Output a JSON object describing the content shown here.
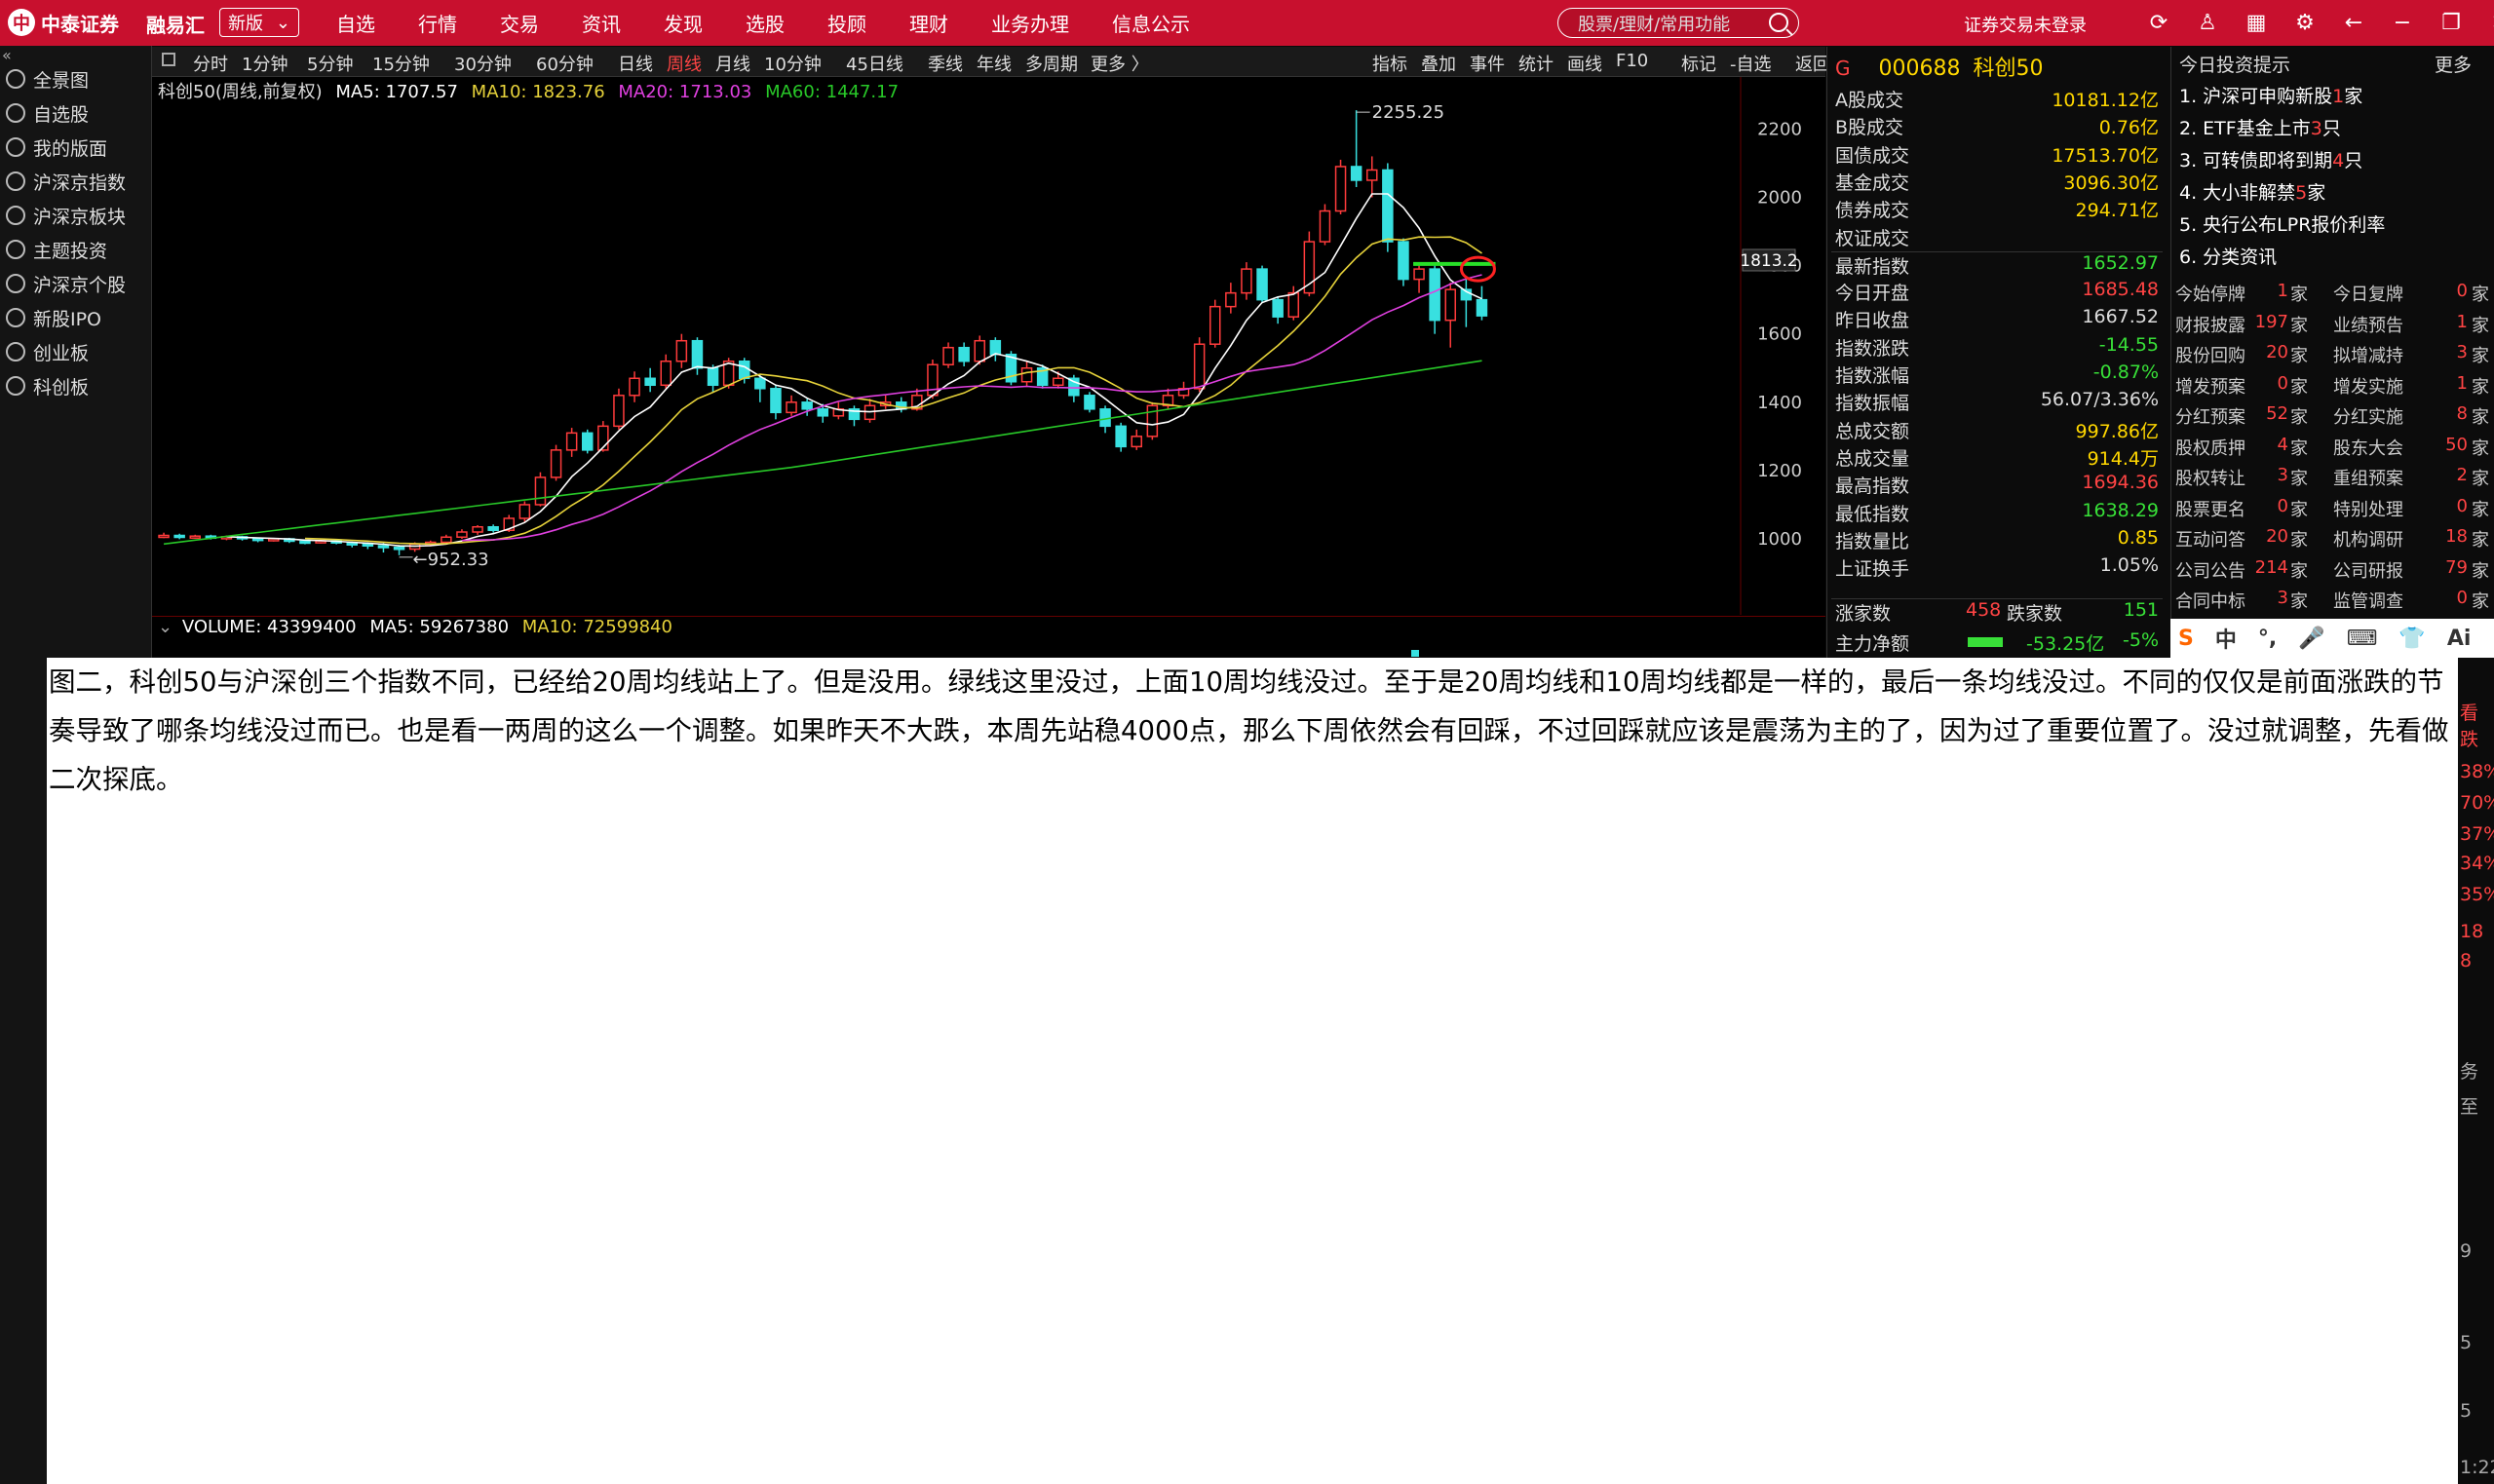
{
  "topbar": {
    "logo_text": "中泰证券",
    "app_name": "融易汇",
    "version": "新版",
    "nav": [
      "自选",
      "行情",
      "交易",
      "资讯",
      "发现",
      "选股",
      "投顾",
      "理财",
      "业务办理",
      "信息公示"
    ],
    "search_placeholder": "股票/理财/常用功能",
    "login_status": "证券交易未登录"
  },
  "sidebar": {
    "items": [
      "全景图",
      "自选股",
      "我的版面",
      "沪深京指数",
      "沪深京板块",
      "主题投资",
      "沪深京个股",
      "新股IPO",
      "创业板",
      "科创板"
    ]
  },
  "periodbar": {
    "periods": [
      "分时",
      "1分钟",
      "5分钟",
      "15分钟",
      "30分钟",
      "60分钟",
      "日线",
      "周线",
      "月线",
      "10分钟",
      "45日线",
      "季线",
      "年线",
      "多周期",
      "更多 〉"
    ],
    "active": "周线",
    "tools": [
      "指标",
      "叠加",
      "事件",
      "统计",
      "画线",
      "F10",
      "标记",
      "-自选",
      "返回"
    ]
  },
  "chart": {
    "title": "科创50(周线,前复权)",
    "ma5": "MA5: 1707.57",
    "ma10": "MA10: 1823.76",
    "ma20": "MA20: 1713.03",
    "ma60": "MA60: 1447.17",
    "high_label": "2255.25",
    "low_label": "952.33",
    "price_marker": "1813.2",
    "volume": "VOLUME: 43399400",
    "vol_ma5": "MA5: 59267380",
    "vol_ma10": "MA10: 72599840",
    "y_ticks": [
      "2200",
      "2000",
      "1800",
      "1600",
      "1400",
      "1200",
      "1000"
    ]
  },
  "colors": {
    "up": "#ff3b3b",
    "down": "#38e0e0",
    "ma5": "#ffffff",
    "ma10": "#e6d23a",
    "ma20": "#e040e0",
    "ma60": "#28c828",
    "topbar": "#c8102e"
  },
  "quote": {
    "code": "000688",
    "name": "科创50",
    "rows": [
      {
        "label": "A股成交",
        "value": "10181.12亿",
        "color": "#ffd700"
      },
      {
        "label": "B股成交",
        "value": "0.76亿",
        "color": "#ffd700"
      },
      {
        "label": "国债成交",
        "value": "17513.70亿",
        "color": "#ffd700"
      },
      {
        "label": "基金成交",
        "value": "3096.30亿",
        "color": "#ffd700"
      },
      {
        "label": "债券成交",
        "value": "294.71亿",
        "color": "#ffd700"
      },
      {
        "label": "权证成交",
        "value": "",
        "color": "#ffd700"
      },
      {
        "label": "最新指数",
        "value": "1652.97",
        "color": "#38e038"
      },
      {
        "label": "今日开盘",
        "value": "1685.48",
        "color": "#ff4444"
      },
      {
        "label": "昨日收盘",
        "value": "1667.52",
        "color": "#dddddd"
      },
      {
        "label": "指数涨跌",
        "value": "-14.55",
        "color": "#38e038"
      },
      {
        "label": "指数涨幅",
        "value": "-0.87%",
        "color": "#38e038"
      },
      {
        "label": "指数振幅",
        "value": "56.07/3.36%",
        "color": "#dddddd"
      },
      {
        "label": "总成交额",
        "value": "997.86亿",
        "color": "#ffd700"
      },
      {
        "label": "总成交量",
        "value": "914.4万",
        "color": "#ffd700"
      },
      {
        "label": "最高指数",
        "value": "1694.36",
        "color": "#ff4444"
      },
      {
        "label": "最低指数",
        "value": "1638.29",
        "color": "#38e038"
      },
      {
        "label": "指数量比",
        "value": "0.85",
        "color": "#ffd700"
      },
      {
        "label": "上证换手",
        "value": "1.05%",
        "color": "#dddddd"
      }
    ],
    "rise_label": "涨家数",
    "rise_count": "458",
    "fall_label": "跌家数",
    "fall_count": "151",
    "flow_label": "主力净额",
    "flow_value": "-53.25亿",
    "flow_pct": "-5%"
  },
  "news": {
    "title": "今日投资提示",
    "more": "更多",
    "items": [
      {
        "pre": "1. 沪深可申购新股",
        "num": "1",
        "post": "家"
      },
      {
        "pre": "2. ETF基金上市",
        "num": "3",
        "post": "只"
      },
      {
        "pre": "3. 可转债即将到期",
        "num": "4",
        "post": "只"
      },
      {
        "pre": "4. 大小非解禁",
        "num": "5",
        "post": "家"
      },
      {
        "pre": "5. 央行公布LPR报价利率",
        "num": "",
        "post": ""
      },
      {
        "pre": "6. 分类资讯",
        "num": "",
        "post": ""
      }
    ],
    "stats": [
      [
        "今始停牌",
        "1",
        "今日复牌",
        "0"
      ],
      [
        "财报披露",
        "197",
        "业绩预告",
        "1"
      ],
      [
        "股份回购",
        "20",
        "拟增减持",
        "3"
      ],
      [
        "增发预案",
        "0",
        "增发实施",
        "1"
      ],
      [
        "分红预案",
        "52",
        "分红实施",
        "8"
      ],
      [
        "股权质押",
        "4",
        "股东大会",
        "50"
      ],
      [
        "股权转让",
        "3",
        "重组预案",
        "2"
      ],
      [
        "股票更名",
        "0",
        "特别处理",
        "0"
      ],
      [
        "互动问答",
        "20",
        "机构调研",
        "18"
      ],
      [
        "公司公告",
        "214",
        "公司研报",
        "79"
      ],
      [
        "合同中标",
        "3",
        "监管调查",
        "0"
      ]
    ],
    "unit": "家"
  },
  "ime": [
    "S",
    "中",
    "°,",
    "🎤",
    "⌨",
    "👕",
    "Ai"
  ],
  "overlay": {
    "text": "图二，科创50与沪深创三个指数不同，已经给20周均线站上了。但是没用。绿线这里没过，上面10周均线没过。至于是20周均线和10周均线都是一样的，最后一条均线没过。不同的仅仅是前面涨跌的节奏导致了哪条均线没过而已。也是看一两周的这么一个调整。如果昨天不大跌，本周先站稳4000点，那么下周依然会有回踩，不过回踩就应该是震荡为主的了，因为过了重要位置了。没过就调整，先看做二次探底。"
  },
  "bottom_right": [
    "看跌",
    "38%",
    "70%",
    "37%",
    "34%",
    "35%",
    "18",
    "8",
    "务",
    "至",
    "9",
    "5",
    "5",
    "1:22"
  ]
}
